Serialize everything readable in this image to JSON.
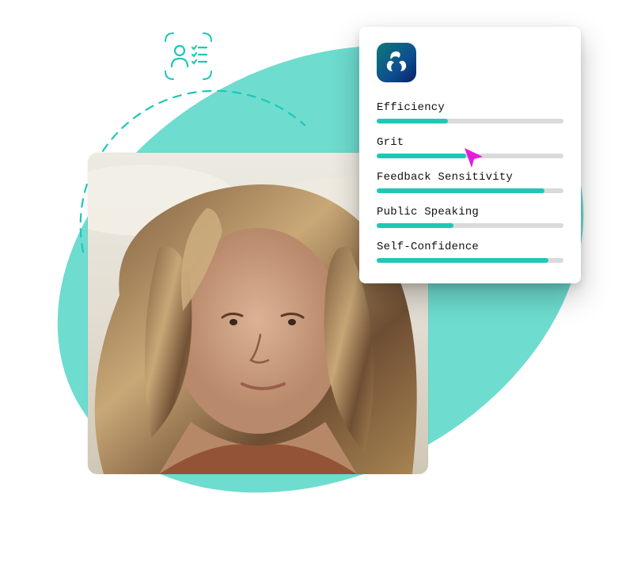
{
  "colors": {
    "accent": "#1FC7B6",
    "blob": "#6EDCCF",
    "bar_track": "#DADADA",
    "cursor": "#E61DDB"
  },
  "icons": {
    "checklist": "person-checklist-icon",
    "app": "triad-logo-icon",
    "cursor": "pointer-cursor-icon"
  },
  "traits": [
    {
      "label": "Efficiency",
      "value": 38
    },
    {
      "label": "Grit",
      "value": 48,
      "show_cursor": true
    },
    {
      "label": "Feedback Sensitivity",
      "value": 90
    },
    {
      "label": "Public Speaking",
      "value": 41
    },
    {
      "label": "Self-Confidence",
      "value": 92
    }
  ]
}
